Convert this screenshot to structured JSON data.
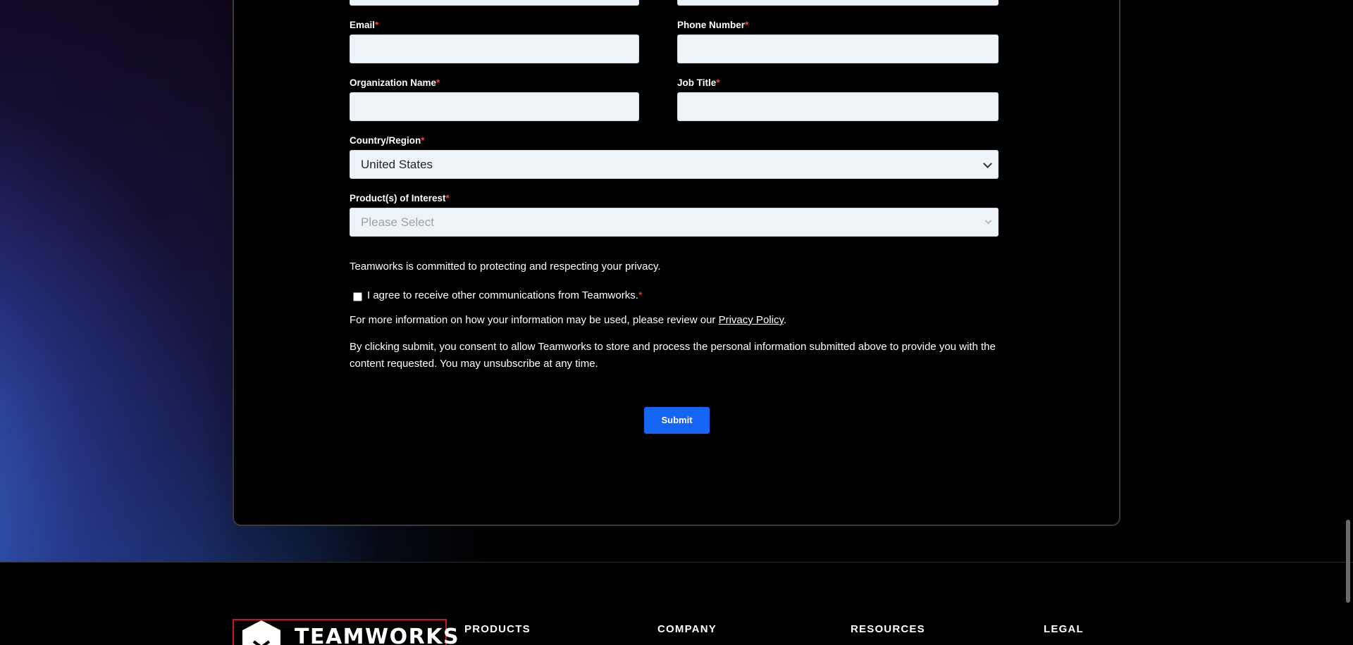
{
  "form": {
    "email_label": "Email",
    "phone_label": "Phone Number",
    "org_label": "Organization Name",
    "job_label": "Job Title",
    "country_label": "Country/Region",
    "country_value": "United States",
    "product_label": "Product(s) of Interest",
    "product_placeholder": "Please Select",
    "required_mark": "*",
    "privacy_text": "Teamworks is committed to protecting and respecting your privacy.",
    "consent_label": "I agree to receive other communications from Teamworks.",
    "more_info_text": "For more information on how your information may be used, please review our ",
    "privacy_link": "Privacy Policy",
    "more_info_end": ".",
    "submit_consent_text": "By clicking submit, you consent to allow Teamworks to store and process the personal information submitted above to provide you with the content requested. You may unsubscribe at any time.",
    "submit_label": "Submit"
  },
  "footer": {
    "logo_text": "TEAMWORKS",
    "columns": [
      "PRODUCTS",
      "COMPANY",
      "RESOURCES",
      "LEGAL"
    ]
  },
  "colors": {
    "accent": "#1565f5",
    "required": "#e5484d",
    "logo_border": "#d0141e"
  }
}
